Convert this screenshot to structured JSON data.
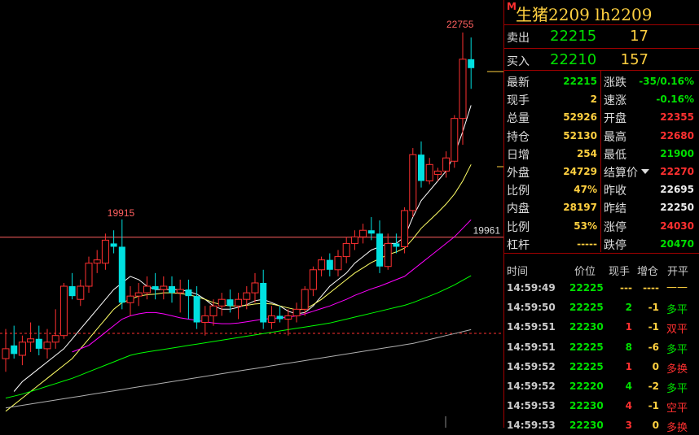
{
  "colors": {
    "up": "#ff3030",
    "down": "#00e0e0",
    "ma1": "#ffffff",
    "ma2": "#ffff66",
    "ma3": "#ff00ff",
    "ma4": "#00ff00",
    "ma5": "#b0b0b0",
    "grid": "#ff3030"
  },
  "header": {
    "marker": "M",
    "title": "生猪2209  lh2209"
  },
  "quote": {
    "sell": {
      "label": "卖出",
      "price": "22215",
      "volume": "17"
    },
    "buy": {
      "label": "买入",
      "price": "22210",
      "volume": "157"
    }
  },
  "stats_left": [
    {
      "label": "最新",
      "value": "22215",
      "color": "#00e000"
    },
    {
      "label": "现手",
      "value": "2",
      "color": "#ffd040"
    },
    {
      "label": "总量",
      "value": "52926",
      "color": "#ffd040"
    },
    {
      "label": "持仓",
      "value": "52130",
      "color": "#ffd040"
    },
    {
      "label": "日增",
      "value": "254",
      "color": "#ffd040"
    },
    {
      "label": "外盘",
      "value": "24729",
      "color": "#ffd040"
    },
    {
      "label": "比例",
      "value": "47%",
      "color": "#ffd040"
    },
    {
      "label": "内盘",
      "value": "28197",
      "color": "#ffd040"
    },
    {
      "label": "比例",
      "value": "53%",
      "color": "#ffd040"
    },
    {
      "label": "杠杆",
      "value": "-----",
      "color": "#ffd040"
    }
  ],
  "stats_right": [
    {
      "label": "涨跌",
      "value": "-35/0.16%",
      "color": "#00e000"
    },
    {
      "label": "速涨",
      "value": "-0.16%",
      "color": "#00e000"
    },
    {
      "label": "开盘",
      "value": "22355",
      "color": "#ff3030"
    },
    {
      "label": "最高",
      "value": "22680",
      "color": "#ff3030"
    },
    {
      "label": "最低",
      "value": "21900",
      "color": "#00e000"
    },
    {
      "label": "结算价",
      "value": "22270",
      "color": "#ff3030",
      "dropdown": true
    },
    {
      "label": "昨收",
      "value": "22695",
      "color": "#eeeeee"
    },
    {
      "label": "昨结",
      "value": "22250",
      "color": "#eeeeee"
    },
    {
      "label": "涨停",
      "value": "24030",
      "color": "#ff3030"
    },
    {
      "label": "跌停",
      "value": "20470",
      "color": "#00e000"
    }
  ],
  "ticks": {
    "headers": [
      "时间",
      "价位",
      "现手",
      "增仓",
      "开平"
    ],
    "rows": [
      {
        "time": "14:59:49",
        "price": "22225",
        "vol": "---",
        "chg": "----",
        "kind": "——",
        "color": "#ffd040"
      },
      {
        "time": "14:59:50",
        "price": "22225",
        "vol": "2",
        "chg": "-1",
        "kind": "多平",
        "color": "#00e000"
      },
      {
        "time": "14:59:51",
        "price": "22230",
        "vol": "1",
        "chg": "-1",
        "kind": "双平",
        "color": "#ff3030"
      },
      {
        "time": "14:59:51",
        "price": "22225",
        "vol": "8",
        "chg": "-6",
        "kind": "多平",
        "color": "#00e000"
      },
      {
        "time": "14:59:52",
        "price": "22225",
        "vol": "1",
        "chg": "0",
        "kind": "多换",
        "color": "#ff3030"
      },
      {
        "time": "14:59:52",
        "price": "22220",
        "vol": "4",
        "chg": "-2",
        "kind": "多平",
        "color": "#00e000"
      },
      {
        "time": "14:59:53",
        "price": "22230",
        "vol": "4",
        "chg": "-1",
        "kind": "空平",
        "color": "#ff3030"
      },
      {
        "time": "14:59:53",
        "price": "22230",
        "vol": "3",
        "chg": "0",
        "kind": "多换",
        "color": "#ff3030"
      }
    ]
  },
  "chart_data": {
    "type": "candlestick",
    "ylim": [
      16750,
      23250
    ],
    "annotations": {
      "high_label": "22755",
      "low_label": "19915",
      "right_label": "19961"
    },
    "candles": [
      {
        "o": 17800,
        "h": 18250,
        "l": 17600,
        "c": 17950
      },
      {
        "o": 18000,
        "h": 18300,
        "l": 17800,
        "c": 17870
      },
      {
        "o": 17850,
        "h": 18150,
        "l": 17700,
        "c": 18050
      },
      {
        "o": 18050,
        "h": 18350,
        "l": 17900,
        "c": 18100
      },
      {
        "o": 18100,
        "h": 18300,
        "l": 17850,
        "c": 17950
      },
      {
        "o": 17950,
        "h": 18250,
        "l": 17800,
        "c": 18050
      },
      {
        "o": 18050,
        "h": 18550,
        "l": 17950,
        "c": 18150
      },
      {
        "o": 18150,
        "h": 18950,
        "l": 18100,
        "c": 18900
      },
      {
        "o": 18900,
        "h": 19100,
        "l": 18700,
        "c": 18750
      },
      {
        "o": 18700,
        "h": 19000,
        "l": 18600,
        "c": 18900
      },
      {
        "o": 18900,
        "h": 19350,
        "l": 18800,
        "c": 19250
      },
      {
        "o": 19250,
        "h": 19450,
        "l": 19100,
        "c": 19300
      },
      {
        "o": 19250,
        "h": 19700,
        "l": 19150,
        "c": 19600
      },
      {
        "o": 19550,
        "h": 19750,
        "l": 19400,
        "c": 19500
      },
      {
        "o": 19500,
        "h": 19915,
        "l": 18550,
        "c": 18650
      },
      {
        "o": 18650,
        "h": 18900,
        "l": 18450,
        "c": 18750
      },
      {
        "o": 18750,
        "h": 18950,
        "l": 18600,
        "c": 18800
      },
      {
        "o": 18800,
        "h": 19050,
        "l": 18700,
        "c": 18900
      },
      {
        "o": 18900,
        "h": 19100,
        "l": 18700,
        "c": 18850
      },
      {
        "o": 18850,
        "h": 19050,
        "l": 18700,
        "c": 18900
      },
      {
        "o": 18900,
        "h": 19050,
        "l": 18650,
        "c": 18800
      },
      {
        "o": 18800,
        "h": 19000,
        "l": 18500,
        "c": 18850
      },
      {
        "o": 18850,
        "h": 19000,
        "l": 18400,
        "c": 18750
      },
      {
        "o": 18750,
        "h": 18900,
        "l": 18250,
        "c": 18350
      },
      {
        "o": 18350,
        "h": 18600,
        "l": 18150,
        "c": 18450
      },
      {
        "o": 18450,
        "h": 18700,
        "l": 18300,
        "c": 18600
      },
      {
        "o": 18600,
        "h": 18800,
        "l": 18450,
        "c": 18700
      },
      {
        "o": 18700,
        "h": 18850,
        "l": 18500,
        "c": 18600
      },
      {
        "o": 18600,
        "h": 18800,
        "l": 18400,
        "c": 18700
      },
      {
        "o": 18700,
        "h": 18900,
        "l": 18550,
        "c": 18800
      },
      {
        "o": 18800,
        "h": 19100,
        "l": 18650,
        "c": 18950
      },
      {
        "o": 18950,
        "h": 19150,
        "l": 18250,
        "c": 18350
      },
      {
        "o": 18350,
        "h": 18600,
        "l": 18250,
        "c": 18450
      },
      {
        "o": 18450,
        "h": 18600,
        "l": 18350,
        "c": 18400
      },
      {
        "o": 18400,
        "h": 18550,
        "l": 18150,
        "c": 18450
      },
      {
        "o": 18450,
        "h": 18650,
        "l": 18350,
        "c": 18550
      },
      {
        "o": 18550,
        "h": 18900,
        "l": 18450,
        "c": 18850
      },
      {
        "o": 18850,
        "h": 19200,
        "l": 18750,
        "c": 19150
      },
      {
        "o": 19150,
        "h": 19350,
        "l": 19050,
        "c": 19300
      },
      {
        "o": 19300,
        "h": 19400,
        "l": 19050,
        "c": 19150
      },
      {
        "o": 19150,
        "h": 19450,
        "l": 19050,
        "c": 19350
      },
      {
        "o": 19350,
        "h": 19650,
        "l": 19250,
        "c": 19550
      },
      {
        "o": 19550,
        "h": 19750,
        "l": 19450,
        "c": 19650
      },
      {
        "o": 19650,
        "h": 19850,
        "l": 19550,
        "c": 19750
      },
      {
        "o": 19750,
        "h": 19950,
        "l": 19600,
        "c": 19700
      },
      {
        "o": 19700,
        "h": 19900,
        "l": 19100,
        "c": 19200
      },
      {
        "o": 19200,
        "h": 19700,
        "l": 19150,
        "c": 19550
      },
      {
        "o": 19550,
        "h": 19700,
        "l": 19400,
        "c": 19500
      },
      {
        "o": 19500,
        "h": 20100,
        "l": 19400,
        "c": 20050
      },
      {
        "o": 20050,
        "h": 21000,
        "l": 19950,
        "c": 20900
      },
      {
        "o": 20900,
        "h": 21100,
        "l": 20400,
        "c": 20500
      },
      {
        "o": 20500,
        "h": 20850,
        "l": 20450,
        "c": 20750
      },
      {
        "o": 20600,
        "h": 20700,
        "l": 20500,
        "c": 20650
      },
      {
        "o": 20650,
        "h": 20950,
        "l": 20550,
        "c": 20850
      },
      {
        "o": 20800,
        "h": 21500,
        "l": 20700,
        "c": 21450
      },
      {
        "o": 21450,
        "h": 22755,
        "l": 21050,
        "c": 22350
      },
      {
        "o": 22350,
        "h": 22680,
        "l": 21900,
        "c": 22215
      }
    ],
    "ma_series": [
      {
        "ma": [
          null,
          17300,
          17450,
          17550,
          17650,
          17750,
          17850,
          17950,
          18100,
          18250,
          18400,
          18550,
          18700,
          18850,
          18950,
          19050,
          19000,
          18900,
          18850,
          18850,
          18850,
          18850,
          18820,
          18780,
          18700,
          18600,
          18550,
          18550,
          18580,
          18620,
          18680,
          18700,
          18650,
          18600,
          18520,
          18480,
          18500,
          18600,
          18750,
          18900,
          19000,
          19100,
          19250,
          19350,
          19450,
          19500,
          19550,
          19550,
          19650,
          19950,
          20200,
          20350,
          20500,
          20650,
          20900,
          21250,
          21650
        ]
      },
      {
        "ma": [
          17000,
          17100,
          17200,
          17300,
          17400,
          17500,
          17600,
          17700,
          17800,
          17950,
          18100,
          18250,
          18400,
          18550,
          18650,
          18700,
          18750,
          18770,
          18780,
          18800,
          18800,
          18790,
          18770,
          18740,
          18700,
          18650,
          18620,
          18600,
          18600,
          18610,
          18630,
          18640,
          18630,
          18600,
          18570,
          18540,
          18550,
          18620,
          18700,
          18800,
          18900,
          19000,
          19100,
          19180,
          19260,
          19320,
          19380,
          19420,
          19480,
          19620,
          19780,
          19900,
          20020,
          20150,
          20300,
          20500,
          20750
        ]
      },
      {
        "ma": [
          null,
          null,
          null,
          null,
          null,
          null,
          null,
          null,
          17900,
          17950,
          18000,
          18100,
          18200,
          18300,
          18400,
          18450,
          18480,
          18500,
          18500,
          18480,
          18450,
          18420,
          18400,
          18380,
          18360,
          18340,
          18330,
          18330,
          18340,
          18360,
          18380,
          18400,
          18410,
          18420,
          18430,
          18450,
          18480,
          18520,
          18560,
          18600,
          18650,
          18700,
          18760,
          18810,
          18860,
          18900,
          18950,
          19000,
          19050,
          19150,
          19250,
          19350,
          19450,
          19550,
          19650,
          19780,
          19910
        ]
      },
      {
        "ma": [
          17200,
          17230,
          17260,
          17300,
          17340,
          17380,
          17420,
          17460,
          17500,
          17550,
          17600,
          17650,
          17700,
          17750,
          17800,
          17850,
          17880,
          17900,
          17920,
          17940,
          17960,
          17980,
          18000,
          18020,
          18040,
          18060,
          18080,
          18100,
          18120,
          18140,
          18160,
          18180,
          18200,
          18220,
          18240,
          18260,
          18280,
          18300,
          18320,
          18340,
          18370,
          18400,
          18430,
          18460,
          18490,
          18520,
          18550,
          18580,
          18610,
          18650,
          18700,
          18750,
          18800,
          18860,
          18920,
          18990,
          19060
        ]
      },
      {
        "ma": [
          17050,
          17070,
          17090,
          17110,
          17130,
          17150,
          17170,
          17190,
          17210,
          17230,
          17250,
          17270,
          17290,
          17310,
          17330,
          17350,
          17370,
          17390,
          17410,
          17430,
          17450,
          17470,
          17490,
          17510,
          17530,
          17550,
          17570,
          17590,
          17610,
          17630,
          17650,
          17670,
          17690,
          17710,
          17730,
          17750,
          17770,
          17790,
          17810,
          17830,
          17850,
          17870,
          17890,
          17910,
          17930,
          17950,
          17970,
          17990,
          18010,
          18030,
          18060,
          18090,
          18120,
          18150,
          18180,
          18210,
          18240
        ]
      }
    ]
  }
}
